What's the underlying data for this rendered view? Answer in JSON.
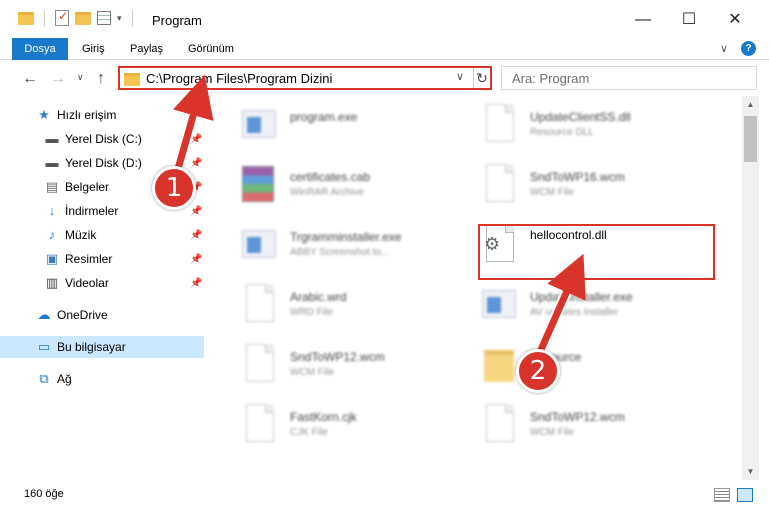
{
  "window": {
    "title": "Program",
    "minimize": "—",
    "maximize": "☐",
    "close": "✕"
  },
  "ribbon": {
    "tabs": [
      "Dosya",
      "Giriş",
      "Paylaş",
      "Görünüm"
    ],
    "collapse": "∨",
    "help": "?"
  },
  "nav": {
    "back": "←",
    "forward": "→",
    "recent": "∨",
    "up": "↑",
    "address": "C:\\Program Files\\Program Dizini",
    "address_dropdown": "∨",
    "refresh": "↻",
    "search_placeholder": "Ara: Program"
  },
  "sidebar": {
    "items": [
      {
        "label": "Hızlı erişim",
        "icon": "star-icon",
        "pinned": false
      },
      {
        "label": "Yerel Disk (C:)",
        "icon": "drive-icon",
        "pinned": true
      },
      {
        "label": "Yerel Disk (D:)",
        "icon": "drive-icon",
        "pinned": true
      },
      {
        "label": "Belgeler",
        "icon": "documents-icon",
        "pinned": true
      },
      {
        "label": "İndirmeler",
        "icon": "download-icon",
        "pinned": true
      },
      {
        "label": "Müzik",
        "icon": "music-icon",
        "pinned": true
      },
      {
        "label": "Resimler",
        "icon": "pictures-icon",
        "pinned": true
      },
      {
        "label": "Videolar",
        "icon": "videos-icon",
        "pinned": true
      },
      {
        "label": "OneDrive",
        "icon": "cloud-icon",
        "pinned": false
      },
      {
        "label": "Bu bilgisayar",
        "icon": "computer-icon",
        "pinned": false
      },
      {
        "label": "Ağ",
        "icon": "network-icon",
        "pinned": false
      }
    ]
  },
  "files": [
    {
      "name": "program.exe",
      "type": ""
    },
    {
      "name": "UpdateClientSS.dll",
      "type": "Resource DLL"
    },
    {
      "name": "certificates.cab",
      "type": "WinRAR Archive"
    },
    {
      "name": "SndToWP16.wcm",
      "type": "WCM File"
    },
    {
      "name": "Trgramminstaller.exe",
      "type": "ABBY Screenshot to..."
    },
    {
      "name": "hellocontrol.dll",
      "type": ""
    },
    {
      "name": "Arabic.wrd",
      "type": "WRD File"
    },
    {
      "name": "UpdateInstaller.exe",
      "type": "AV updates installer"
    },
    {
      "name": "SndToWP12.wcm",
      "type": "WCM File"
    },
    {
      "name": "Resource",
      "type": ""
    },
    {
      "name": "FastKorn.cjk",
      "type": "CJK File"
    },
    {
      "name": "SndToWP12.wcm",
      "type": "WCM File"
    }
  ],
  "status": {
    "count": "160 öğe"
  },
  "callouts": [
    "1",
    "2"
  ],
  "colors": {
    "accent": "#1979ca",
    "highlight": "#d9342c",
    "selected": "#cce8ff"
  }
}
